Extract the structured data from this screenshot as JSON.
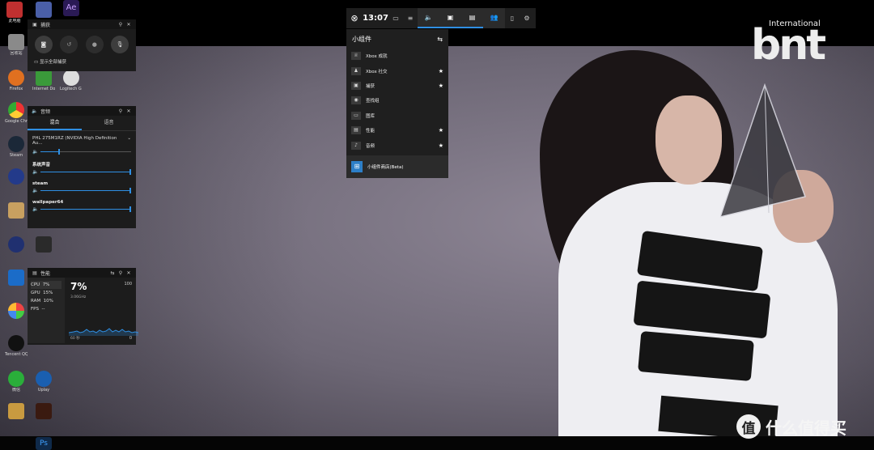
{
  "gamebar": {
    "time": "13:07",
    "xbox_icon": "xbox-icon",
    "tabs": [
      {
        "icon": "audio-icon",
        "active": true
      },
      {
        "icon": "capture-icon",
        "active": true
      },
      {
        "icon": "performance-icon",
        "active": true
      },
      {
        "icon": "xbox-social-icon",
        "active": false
      }
    ]
  },
  "widget_menu": {
    "title": "小组件",
    "items": [
      {
        "label": "Xbox 成就",
        "icon": "trophy-icon",
        "favorite": false
      },
      {
        "label": "Xbox 社交",
        "icon": "social-icon",
        "favorite": true
      },
      {
        "label": "捕获",
        "icon": "capture-icon",
        "favorite": true
      },
      {
        "label": "查找组",
        "icon": "lfg-icon",
        "favorite": false
      },
      {
        "label": "图库",
        "icon": "gallery-icon",
        "favorite": false
      },
      {
        "label": "性能",
        "icon": "performance-icon",
        "favorite": true
      },
      {
        "label": "音频",
        "icon": "audio-icon",
        "favorite": true
      }
    ],
    "store_label": "小组件商店(Beta)",
    "star": "★"
  },
  "capture_panel": {
    "title": "捕获",
    "show_all_label": "显示全部捕获"
  },
  "audio_panel": {
    "title": "音频",
    "tab_mix": "混合",
    "tab_voice": "语音",
    "device": "PHL 275M1RZ (NVIDIA High Definition Au...",
    "master_volume": 0.2,
    "apps": [
      {
        "name": "系统声音",
        "volume": 1.0
      },
      {
        "name": "steam",
        "volume": 1.0
      },
      {
        "name": "wallpaper64",
        "volume": 1.0
      }
    ]
  },
  "performance_panel": {
    "title": "性能",
    "stats": [
      {
        "label": "CPU",
        "value": "7%"
      },
      {
        "label": "GPU",
        "value": "15%"
      },
      {
        "label": "RAM",
        "value": "10%"
      },
      {
        "label": "FPS",
        "value": "--"
      }
    ],
    "big_value": "7%",
    "max_label": "100",
    "freq": "3.06GHz",
    "duration": "60 秒",
    "min_label": "0"
  },
  "desktop_icons": [
    {
      "label": "此电脑"
    },
    {
      "label": "Ae"
    },
    {
      "label": "回收站"
    },
    {
      "label": "Firefox"
    },
    {
      "label": "Internet Download"
    },
    {
      "label": "Logitech G HUB"
    },
    {
      "label": "Google Chrome"
    },
    {
      "label": "Steam"
    },
    {
      "label": "Uplay"
    },
    {
      "label": "Tencent QQ"
    },
    {
      "label": "微信"
    },
    {
      "label": "Ps"
    }
  ],
  "watermark": {
    "icon_text": "值",
    "text": "什么值得买"
  },
  "logo": {
    "small": "International",
    "big": "bnt"
  },
  "colors": {
    "accent": "#2f8fe3",
    "panel": "#1c1c1c",
    "panel_title": "#151515"
  }
}
